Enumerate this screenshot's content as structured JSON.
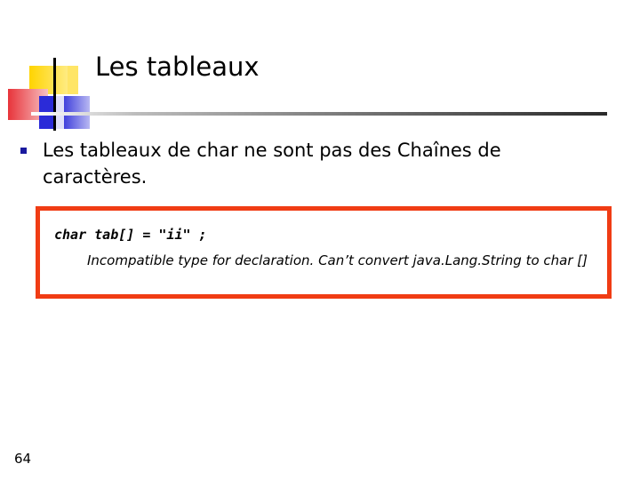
{
  "slide": {
    "title": "Les tableaux",
    "bullet": "Les tableaux de char ne sont pas des Chaînes de caractères.",
    "code": {
      "statement": "char tab[] = \"ii\" ;",
      "error": "Incompatible type for declaration. Can’t convert java.Lang.String to char []"
    },
    "page_number": "64"
  },
  "colors": {
    "code_border": "#f03c14",
    "bullet": "#1a1a9e",
    "logo_yellow": "#ffd400",
    "logo_red": "#e8343a",
    "logo_blue": "#2b2bd8"
  }
}
